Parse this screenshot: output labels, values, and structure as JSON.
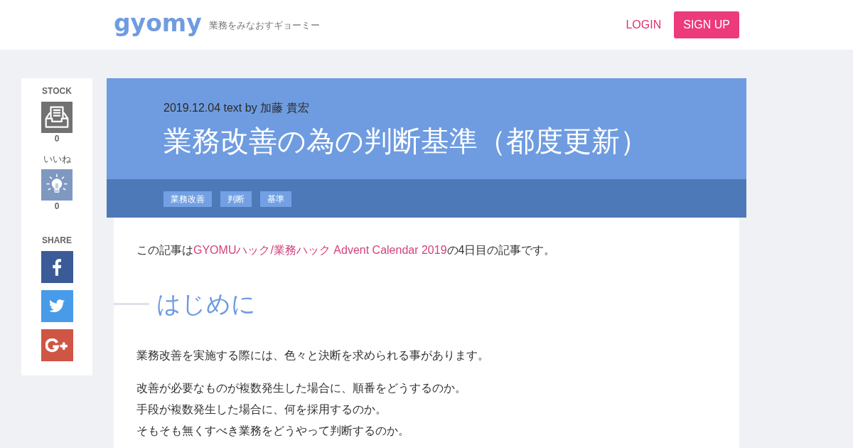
{
  "header": {
    "logo": "gyomy",
    "tagline": "業務をみなおすギョーミー",
    "nav": [
      {
        "kind": "link",
        "label": "LOGIN"
      },
      {
        "kind": "button",
        "label": "SIGN UP"
      }
    ]
  },
  "sidebar": {
    "actions": [
      {
        "kind": "stock",
        "label": "STOCK",
        "count": "0"
      },
      {
        "kind": "like",
        "label": "いいね",
        "count": "0"
      }
    ],
    "share": {
      "label": "SHARE",
      "buttons": [
        {
          "kind": "facebook"
        },
        {
          "kind": "twitter"
        },
        {
          "kind": "google-plus"
        }
      ]
    }
  },
  "article": {
    "meta": "2019.12.04 text by 加藤 貴宏",
    "title": "業務改善の為の判断基準（都度更新）",
    "tags": [
      "業務改善",
      "判断",
      "基準"
    ],
    "body": [
      {
        "kind": "intro",
        "before": "この記事は",
        "link": "GYOMUハック/業務ハック Advent Calendar 2019",
        "after": "の4日目の記事です。"
      },
      {
        "kind": "heading",
        "text": "はじめに"
      },
      {
        "kind": "paragraph",
        "lines": [
          "業務改善を実施する際には、色々と決断を求められる事があります。"
        ]
      },
      {
        "kind": "paragraph",
        "lines": [
          "改善が必要なものが複数発生した場合に、順番をどうするのか。",
          "手段が複数発生した場合に、何を採用するのか。",
          "そもそも無くすべき業務をどうやって判断するのか。"
        ]
      }
    ]
  }
}
